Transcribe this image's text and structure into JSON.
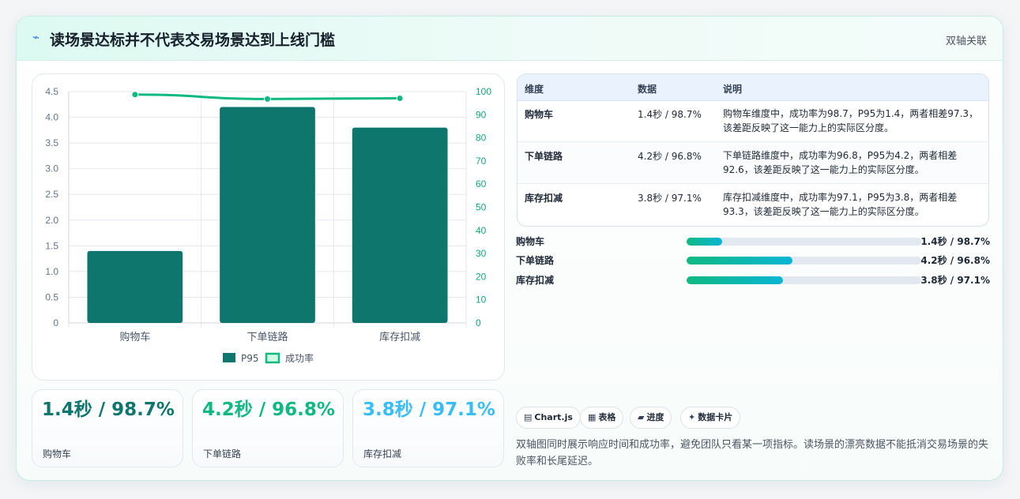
{
  "header": {
    "icon": "lightning-icon",
    "title": "读场景达标并不代表交易场景达到上线门槛",
    "tag": "双轴关联"
  },
  "chart_data": {
    "type": "bar",
    "categories": [
      "购物车",
      "下单链路",
      "库存扣减"
    ],
    "series": [
      {
        "name": "P95",
        "type": "bar",
        "axis": "left",
        "values": [
          1.4,
          4.2,
          3.8
        ],
        "color": "#0f766e"
      },
      {
        "name": "成功率",
        "type": "line",
        "axis": "right",
        "values": [
          98.7,
          96.8,
          97.1
        ],
        "color": "#10b981"
      }
    ],
    "ylim_left": [
      0,
      4.5
    ],
    "yticks_left": [
      "0",
      "0.5",
      "1.0",
      "1.5",
      "2.0",
      "2.5",
      "3.0",
      "3.5",
      "4.0",
      "4.5"
    ],
    "ylim_right": [
      0,
      100
    ],
    "yticks_right": [
      "0",
      "10",
      "20",
      "30",
      "40",
      "50",
      "60",
      "70",
      "80",
      "90",
      "100"
    ],
    "legend_position": "bottom",
    "grid": true
  },
  "kpis": [
    {
      "value": "1.4秒 / 98.7%",
      "label": "购物车",
      "color": "#0f766e"
    },
    {
      "value": "4.2秒 / 96.8%",
      "label": "下单链路",
      "color": "#10b981"
    },
    {
      "value": "3.8秒 / 97.1%",
      "label": "库存扣减",
      "color": "#38bdf8"
    }
  ],
  "table": {
    "headers": [
      "维度",
      "数据",
      "说明"
    ],
    "rows": [
      {
        "dim": "购物车",
        "data": "1.4秒 / 98.7%",
        "desc": "购物车维度中，成功率为98.7，P95为1.4，两者相差97.3，该差距反映了这一能力上的实际区分度。"
      },
      {
        "dim": "下单链路",
        "data": "4.2秒 / 96.8%",
        "desc": "下单链路维度中，成功率为96.8，P95为4.2，两者相差92.6，该差距反映了这一能力上的实际区分度。"
      },
      {
        "dim": "库存扣减",
        "data": "3.8秒 / 97.1%",
        "desc": "库存扣减维度中，成功率为97.1，P95为3.8，两者相差93.3，该差距反映了这一能力上的实际区分度。"
      }
    ]
  },
  "progress": [
    {
      "label": "购物车",
      "value": "1.4秒 / 98.7%",
      "fill_fraction": 0.15
    },
    {
      "label": "下单链路",
      "value": "4.2秒 / 96.8%",
      "fill_fraction": 0.45
    },
    {
      "label": "库存扣减",
      "value": "3.8秒 / 97.1%",
      "fill_fraction": 0.41
    }
  ],
  "chips": [
    {
      "icon": "chart-icon",
      "glyph": "▤",
      "label": "Chart.js"
    },
    {
      "icon": "table-icon",
      "glyph": "▦",
      "label": "表格"
    },
    {
      "icon": "progress-icon",
      "glyph": "▰",
      "label": "进度"
    },
    {
      "icon": "sparkle-icon",
      "glyph": "✦",
      "label": "数据卡片"
    }
  ],
  "note": "双轴图同时展示响应时间和成功率，避免团队只看某一项指标。读场景的漂亮数据不能抵消交易场景的失败率和长尾延迟。"
}
